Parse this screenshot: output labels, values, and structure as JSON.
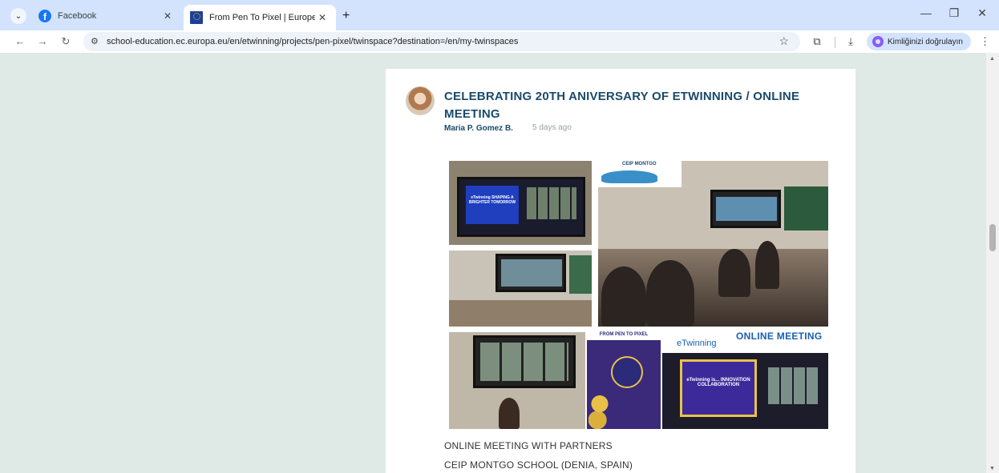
{
  "browser": {
    "tabs": [
      {
        "title": "Facebook",
        "favicon": "facebook-icon",
        "active": false
      },
      {
        "title": "From Pen To Pixel | European Sc",
        "favicon": "eu-flag-icon",
        "active": true
      }
    ],
    "url": "school-education.ec.europa.eu/en/etwinning/projects/pen-pixel/twinspace?destination=/en/my-twinspaces",
    "profile_label": "Kimliğinizi doğrulayın",
    "accent_color": "#d3e3fd"
  },
  "post": {
    "title": "CELEBRATING 20TH ANIVERSARY OF ETWINNING / ONLINE MEETING",
    "author": "Maria P. Gomez B.",
    "time": "5 days ago",
    "images": {
      "slide_text": "eTwinning SHAPING A BRIGHTER TOMORROW",
      "logo_text": "CEIP MONTGO",
      "poster_header": "FROM PEN TO PIXEL",
      "banner_etwinning": "eTwinning",
      "banner_title": "ONLINE MEETING",
      "slide2_text": "eTwinning is... INNOVATION COLLABORATION"
    },
    "captions": [
      "ONLINE MEETING WITH PARTNERS",
      "CEIP MONTGO SCHOOL (DENIA, SPAIN)"
    ]
  },
  "colors": {
    "page_background": "#dfe9e6",
    "title_color": "#1a4a6b"
  }
}
